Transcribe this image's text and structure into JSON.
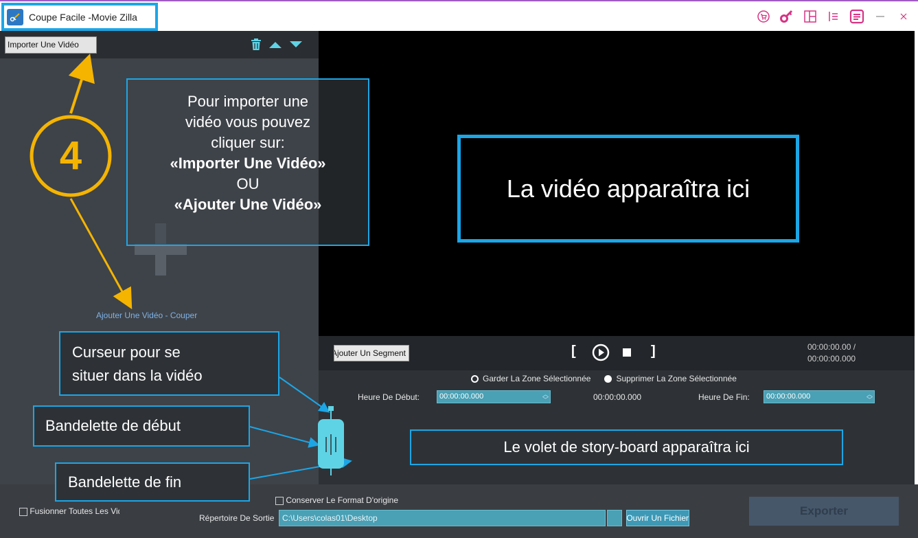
{
  "window": {
    "title": "Coupe Facile -Movie Zilla"
  },
  "left_panel": {
    "import_button": "Importer Une Vidéo",
    "add_video_label": "Ajouter Une Vidéo - Couper"
  },
  "controls": {
    "add_segment_button": "Ajouter Un Segment",
    "bracket_open": "[",
    "bracket_close": "]",
    "timecode_current": "00:00:00.00 /",
    "timecode_total": "00:00:00.000"
  },
  "settings": {
    "radio_keep": "Garder La Zone Sélectionnée",
    "radio_remove": "Supprimer La Zone Sélectionnée",
    "start_label": "Heure De Début:",
    "start_value": "00:00:00.000",
    "middle_time": "00:00:00.000",
    "end_label": "Heure De Fin:",
    "end_value": "00:00:00.000"
  },
  "bottom": {
    "merge_checkbox": "Fusionner Toutes Les Vidéos",
    "keep_format_checkbox": "Conserver Le Format D'origine",
    "directory_label": "Répertoire De Sortie",
    "directory_value": "C:\\Users\\colas01\\Desktop",
    "open_file_button": "Ouvrir Un Fichier",
    "export_button": "Exporter"
  },
  "annotations": {
    "step_number": "4",
    "import_help_line1": "Pour importer une",
    "import_help_line2": "vidéo vous pouvez",
    "import_help_line3": "cliquer sur:",
    "import_help_option1": "«Importer Une Vidéo»",
    "import_help_or": "OU",
    "import_help_option2": "«Ajouter Une Vidéo»",
    "video_placeholder": "La vidéo apparaîtra ici",
    "cursor_line1": "Curseur pour se",
    "cursor_line2": "situer dans la vidéo",
    "start_strip": "Bandelette de début",
    "end_strip": "Bandelette de fin",
    "storyboard": "Le volet de story-board apparaîtra ici"
  },
  "icons": {
    "app": "scissors-icon",
    "cart": "cart-icon",
    "key": "key-icon",
    "layout": "layout-icon",
    "list": "list-icon",
    "menu": "menu-icon",
    "minimize": "minimize-icon",
    "close": "close-icon",
    "trash": "trash-icon",
    "up": "arrow-up-icon",
    "down": "arrow-down-icon"
  },
  "colors": {
    "annotation_blue": "#1ca6e6",
    "annotation_gold": "#f5b400",
    "accent_pink": "#d63384",
    "input_teal": "#4aa0b4"
  }
}
